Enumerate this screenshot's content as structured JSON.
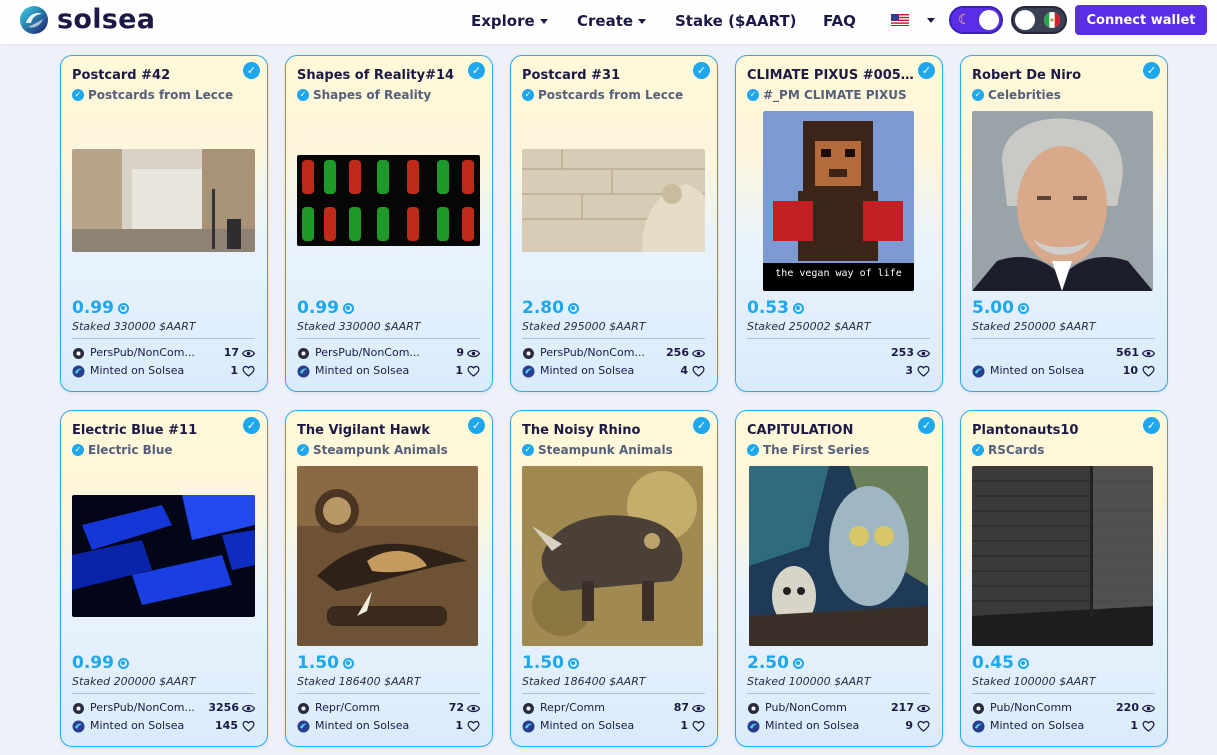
{
  "navbar": {
    "brand": "solsea",
    "menu": [
      {
        "label": "Explore",
        "has_caret": true
      },
      {
        "label": "Create",
        "has_caret": true
      },
      {
        "label": "Stake ($AART)",
        "has_caret": false
      },
      {
        "label": "FAQ",
        "has_caret": false
      }
    ],
    "connect_label": "Connect wallet"
  },
  "colors": {
    "accent": "#5a2ee6",
    "price": "#1ea7ec",
    "card_border": "#2ea8ef"
  },
  "cards": [
    {
      "title": "Postcard #42",
      "collection": "Postcards from Lecce",
      "price": "0.99",
      "staked": "Staked 330000 $AART",
      "license": "PersPub/NonCom...",
      "views": "17",
      "minted": "Minted on Solsea",
      "likes": "1"
    },
    {
      "title": "Shapes of Reality#14",
      "collection": "Shapes of Reality",
      "price": "0.99",
      "staked": "Staked 330000 $AART",
      "license": "PersPub/NonCom...",
      "views": "9",
      "minted": "Minted on Solsea",
      "likes": "1"
    },
    {
      "title": "Postcard #31",
      "collection": "Postcards from Lecce",
      "price": "2.80",
      "staked": "Staked 295000 $AART",
      "license": "PersPub/NonCom...",
      "views": "256",
      "minted": "Minted on Solsea",
      "likes": "4"
    },
    {
      "title": "CLIMATE PIXUS #0053 ...",
      "collection": "#_PM CLIMATE PIXUS",
      "price": "0.53",
      "staked": "Staked 250002 $AART",
      "license": "",
      "views": "253",
      "minted": "",
      "likes": "3",
      "art_caption": "the vegan way of life"
    },
    {
      "title": "Robert De Niro",
      "collection": "Celebrities",
      "price": "5.00",
      "staked": "Staked 250000 $AART",
      "license": "",
      "views": "561",
      "minted": "Minted on Solsea",
      "likes": "10"
    },
    {
      "title": "Electric Blue #11",
      "collection": "Electric Blue",
      "price": "0.99",
      "staked": "Staked 200000 $AART",
      "license": "PersPub/NonCom...",
      "views": "3256",
      "minted": "Minted on Solsea",
      "likes": "145"
    },
    {
      "title": "The Vigilant Hawk",
      "collection": "Steampunk Animals",
      "price": "1.50",
      "staked": "Staked 186400 $AART",
      "license": "Repr/Comm",
      "views": "72",
      "minted": "Minted on Solsea",
      "likes": "1"
    },
    {
      "title": "The Noisy Rhino",
      "collection": "Steampunk Animals",
      "price": "1.50",
      "staked": "Staked 186400 $AART",
      "license": "Repr/Comm",
      "views": "87",
      "minted": "Minted on Solsea",
      "likes": "1"
    },
    {
      "title": "CAPITULATION",
      "collection": "The First Series",
      "price": "2.50",
      "staked": "Staked 100000 $AART",
      "license": "Pub/NonComm",
      "views": "217",
      "minted": "Minted on Solsea",
      "likes": "9"
    },
    {
      "title": "Plantonauts10",
      "collection": "RSCards",
      "price": "0.45",
      "staked": "Staked 100000 $AART",
      "license": "Pub/NonComm",
      "views": "220",
      "minted": "Minted on Solsea",
      "likes": "1"
    }
  ]
}
